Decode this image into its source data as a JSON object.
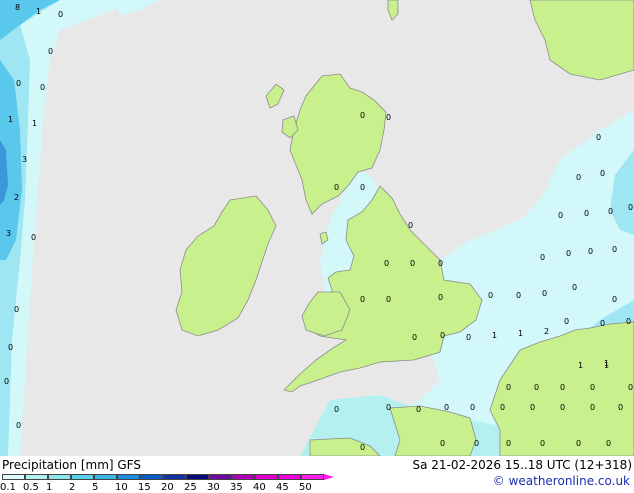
{
  "title": "Precipitation [mm]  GFS",
  "run_info": "Sa 21-02-2026 15..18 UTC (12+318)",
  "copyright": "© weatheronline.co.uk",
  "legend": {
    "ticks": [
      "0.1",
      "0.5",
      "1",
      "2",
      "5",
      "10",
      "15",
      "20",
      "25",
      "30",
      "35",
      "40",
      "45",
      "50"
    ],
    "colors": [
      "#e1fafa",
      "#b4f0f0",
      "#8ce6ee",
      "#5ad2ee",
      "#3cb4e6",
      "#1e8cdc",
      "#0a5ac8",
      "#1432a0",
      "#0a0a78",
      "#6e0aa0",
      "#b400b4",
      "#dc00c8",
      "#f000dc",
      "#ff1ef0"
    ]
  },
  "map_values": [
    {
      "v": "8"
    },
    {
      "v": "1"
    },
    {
      "v": "0"
    },
    {
      "v": "0"
    },
    {
      "v": "0"
    },
    {
      "v": "0"
    },
    {
      "v": "1"
    },
    {
      "v": "1"
    },
    {
      "v": "3"
    },
    {
      "v": "2"
    },
    {
      "v": "3"
    },
    {
      "v": "0"
    },
    {
      "v": "0"
    },
    {
      "v": "0"
    },
    {
      "v": "0"
    },
    {
      "v": "0"
    },
    {
      "v": "0"
    },
    {
      "v": "0"
    },
    {
      "v": "0"
    },
    {
      "v": "0"
    },
    {
      "v": "0"
    },
    {
      "v": "0"
    },
    {
      "v": "0"
    },
    {
      "v": "0"
    },
    {
      "v": "0"
    },
    {
      "v": "0"
    },
    {
      "v": "0"
    },
    {
      "v": "0"
    },
    {
      "v": "0"
    },
    {
      "v": "0"
    },
    {
      "v": "0"
    },
    {
      "v": "0"
    },
    {
      "v": "0"
    },
    {
      "v": "1"
    },
    {
      "v": "1"
    },
    {
      "v": "2"
    },
    {
      "v": "0"
    },
    {
      "v": "0"
    },
    {
      "v": "0"
    },
    {
      "v": "0"
    },
    {
      "v": "0"
    },
    {
      "v": "0"
    },
    {
      "v": "0"
    },
    {
      "v": "0"
    },
    {
      "v": "0"
    },
    {
      "v": "0"
    },
    {
      "v": "0"
    },
    {
      "v": "0"
    },
    {
      "v": "1"
    },
    {
      "v": "1"
    },
    {
      "v": "0"
    },
    {
      "v": "0"
    },
    {
      "v": "0"
    },
    {
      "v": "0"
    },
    {
      "v": "0"
    },
    {
      "v": "0"
    },
    {
      "v": "0"
    },
    {
      "v": "0"
    },
    {
      "v": "0"
    },
    {
      "v": "0"
    },
    {
      "v": "0"
    },
    {
      "v": "0"
    },
    {
      "v": "0"
    },
    {
      "v": "0"
    },
    {
      "v": "0"
    },
    {
      "v": "0"
    },
    {
      "v": "0"
    },
    {
      "v": "0"
    },
    {
      "v": "0"
    },
    {
      "v": "0"
    },
    {
      "v": "0"
    },
    {
      "v": "0"
    },
    {
      "v": "0"
    },
    {
      "v": "1"
    },
    {
      "v": "0"
    },
    {
      "v": "0"
    },
    {
      "v": "0"
    }
  ],
  "colors": {
    "sea": "#e8e8e8",
    "land": "#c8f08c",
    "coast": "#8c8c8c",
    "rain_light": "#d2f8fa",
    "rain_mid": "#9ee6f2",
    "rain_strong": "#5ac8ec",
    "rain_heavy": "#3c96dc"
  }
}
